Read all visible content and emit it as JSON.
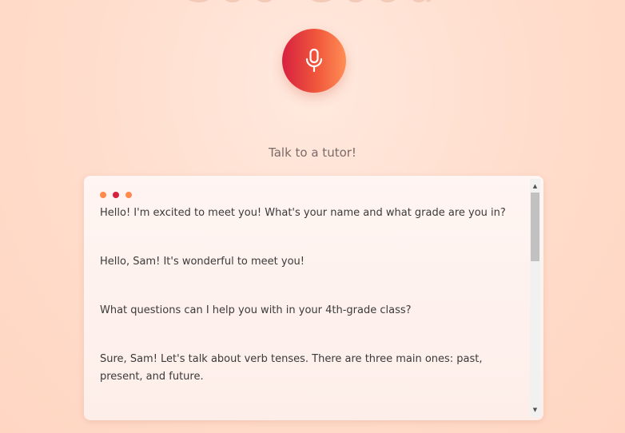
{
  "header": {
    "title": "Soo Good"
  },
  "mic": {
    "icon": "microphone-icon"
  },
  "subtitle": "Talk to a tutor!",
  "chat": {
    "dots": [
      "#ff8a4c",
      "#d7203f",
      "#ff8a4c"
    ],
    "messages": [
      "Hello! I'm excited to meet you! What's your name and what grade are you in?",
      "Hello, Sam! It's wonderful to meet you!",
      "What questions can I help you with in your 4th-grade class?",
      "Sure, Sam! Let's talk about verb tenses. There are three main ones: past, present, and future."
    ]
  },
  "colors": {
    "accent_start": "#d7203f",
    "accent_end": "#ff8e55",
    "background": "#ffdccb"
  }
}
